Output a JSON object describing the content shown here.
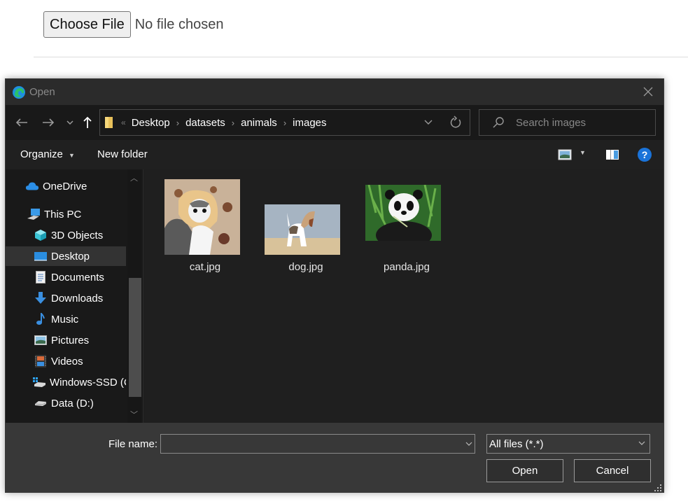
{
  "page": {
    "choose_file_label": "Choose File",
    "no_file_text": "No file chosen"
  },
  "dialog": {
    "title": "Open",
    "app_icon": "edge-icon",
    "address": {
      "crumbs": [
        "Desktop",
        "datasets",
        "animals",
        "images"
      ]
    },
    "search_placeholder": "Search images",
    "toolbar": {
      "organize_label": "Organize",
      "new_folder_label": "New folder"
    },
    "sidebar": {
      "items": [
        {
          "label": "OneDrive",
          "icon": "cloud-icon"
        },
        {
          "label": "This PC",
          "icon": "computer-icon"
        },
        {
          "label": "3D Objects",
          "icon": "cube-icon"
        },
        {
          "label": "Desktop",
          "icon": "desktop-icon",
          "selected": true
        },
        {
          "label": "Documents",
          "icon": "document-icon"
        },
        {
          "label": "Downloads",
          "icon": "download-icon"
        },
        {
          "label": "Music",
          "icon": "music-icon"
        },
        {
          "label": "Pictures",
          "icon": "pictures-icon"
        },
        {
          "label": "Videos",
          "icon": "videos-icon"
        },
        {
          "label": "Windows-SSD (C:)",
          "icon": "windows-drive-icon"
        },
        {
          "label": "Data (D:)",
          "icon": "drive-icon"
        }
      ]
    },
    "files": [
      {
        "name": "cat.jpg"
      },
      {
        "name": "dog.jpg"
      },
      {
        "name": "panda.jpg"
      }
    ],
    "footer": {
      "file_name_label": "File name:",
      "file_name_value": "",
      "file_type": "All files (*.*)",
      "open_label": "Open",
      "cancel_label": "Cancel"
    }
  }
}
